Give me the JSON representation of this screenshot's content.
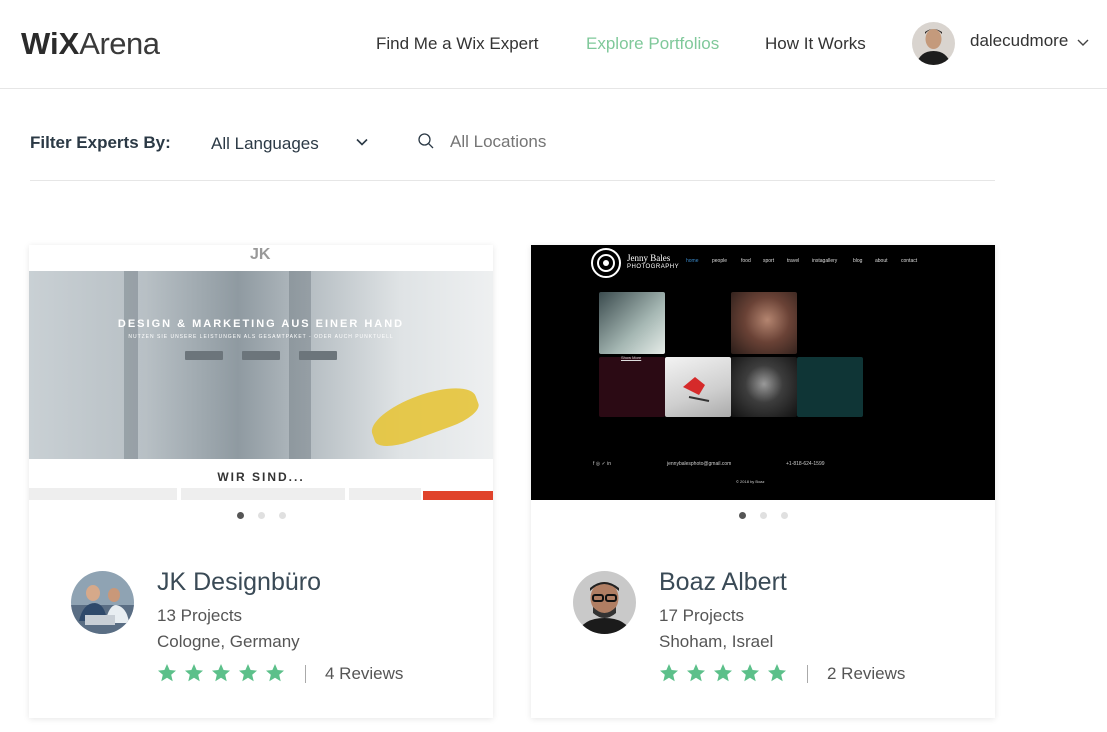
{
  "header": {
    "logo_wix": "WiX",
    "logo_arena": "Arena",
    "nav": [
      {
        "label": "Find Me a Wix Expert",
        "active": false
      },
      {
        "label": "Explore Portfolios",
        "active": true
      },
      {
        "label": "How It Works",
        "active": false
      }
    ],
    "user_name": "dalecudmore"
  },
  "filter": {
    "label": "Filter Experts By:",
    "language_value": "All Languages",
    "location_placeholder": "All Locations"
  },
  "colors": {
    "accent": "#7fc89a",
    "star": "#5cc08a",
    "text": "#2b3945"
  },
  "cards": [
    {
      "name": "JK Designbüro",
      "projects": "13 Projects",
      "location": "Cologne, Germany",
      "rating": 5,
      "reviews": "4 Reviews",
      "slide_index": 0,
      "slide_count": 3,
      "preview": {
        "brand": "JK",
        "headline": "DESIGN & MARKETING AUS EINER HAND",
        "subline": "NUTZEN SIE UNSERE LEISTUNGEN ALS GESAMTPAKET - ODER AUCH PUNKTUELL",
        "section": "WIR SIND..."
      }
    },
    {
      "name": "Boaz Albert",
      "projects": "17 Projects",
      "location": "Shoham, Israel",
      "rating": 5,
      "reviews": "2 Reviews",
      "slide_index": 0,
      "slide_count": 3,
      "preview": {
        "brand_line1": "Jenny Bales",
        "brand_line2": "PHOTOGRAPHY",
        "nav": [
          "home",
          "people",
          "food",
          "sport",
          "travel",
          "instagallery",
          "blog",
          "about",
          "contact"
        ],
        "show_more": "Show More",
        "email": "jennybalesphoto@gmail.com",
        "phone": "+1-818-624-1599",
        "copyright": "© 2018 by Boaz"
      }
    }
  ]
}
